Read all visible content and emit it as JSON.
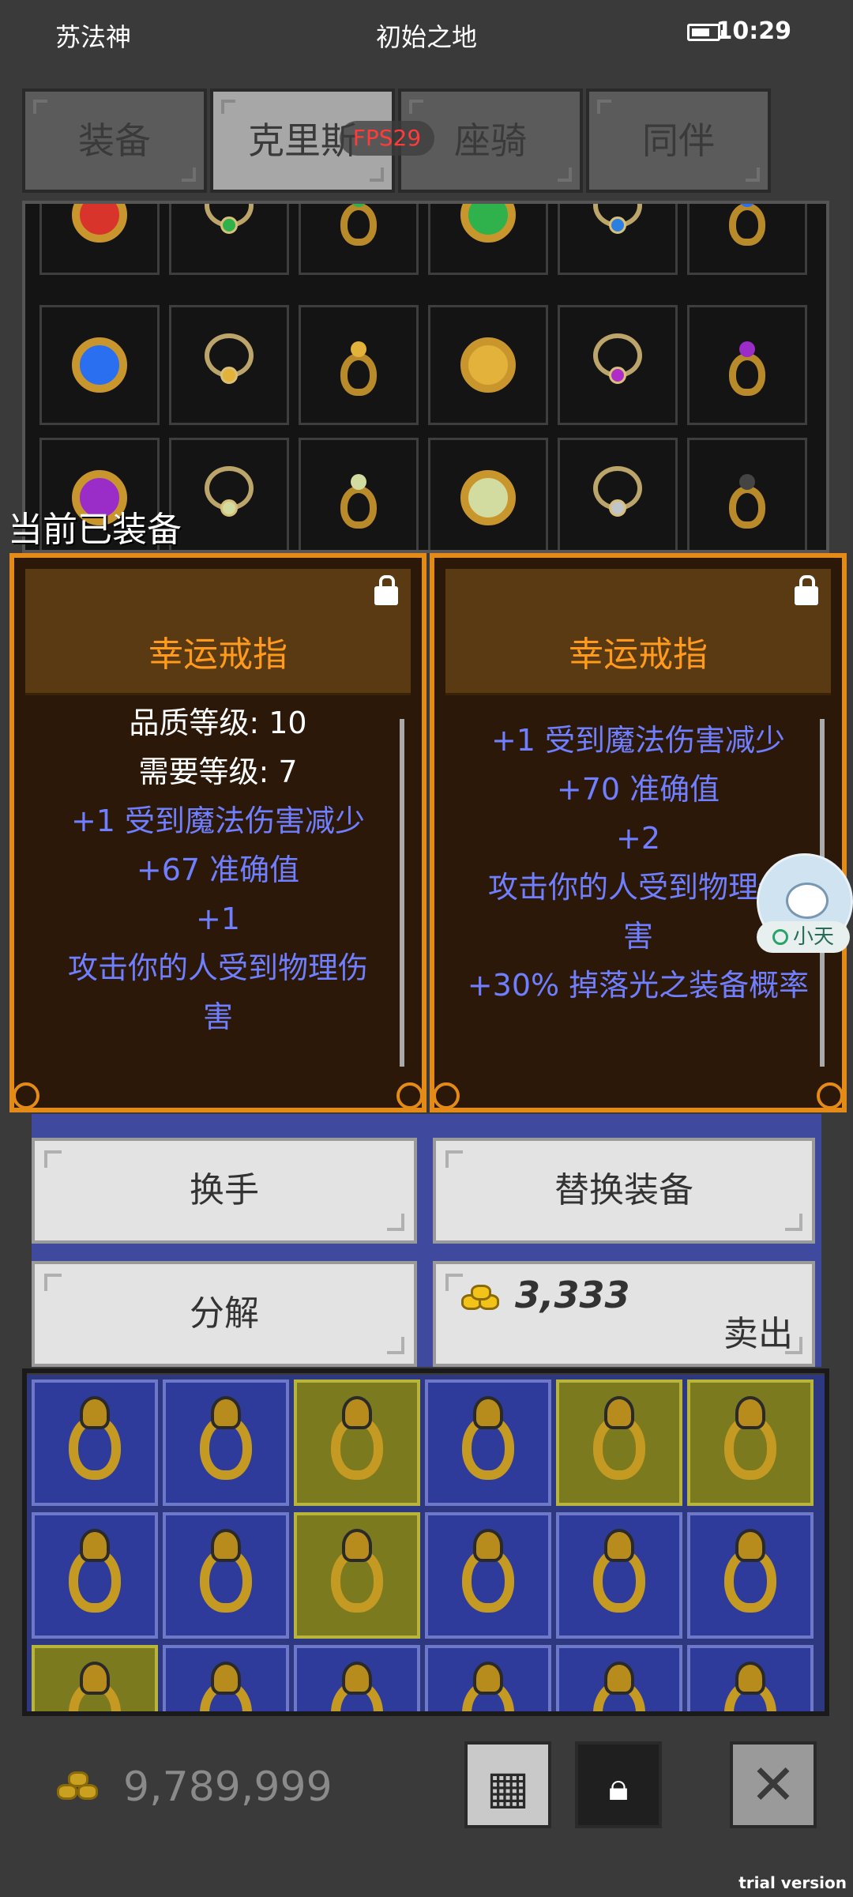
{
  "status": {
    "left_label": "苏法神",
    "center_label": "初始之地",
    "time": "10:29"
  },
  "tabs": [
    {
      "label": "装备",
      "active": false
    },
    {
      "label": "克里斯",
      "active": true
    },
    {
      "label": "座骑",
      "active": false
    },
    {
      "label": "同伴",
      "active": false
    }
  ],
  "fps": "FPS29",
  "equipped_label": "当前已装备",
  "cards": [
    {
      "title": "幸运戒指",
      "lines": [
        {
          "text": "品质等级: 10",
          "color": "white"
        },
        {
          "text": "需要等级: 7",
          "color": "white"
        },
        {
          "text": "+1 受到魔法伤害减少",
          "color": "blue"
        },
        {
          "text": "+67 准确值",
          "color": "blue"
        },
        {
          "text": "+1",
          "color": "blue"
        },
        {
          "text": "攻击你的人受到物理伤",
          "color": "blue"
        },
        {
          "text": "害",
          "color": "blue"
        }
      ]
    },
    {
      "title": "幸运戒指",
      "lines": [
        {
          "text": "+1 受到魔法伤害减少",
          "color": "blue"
        },
        {
          "text": "+70 准确值",
          "color": "blue"
        },
        {
          "text": "+2",
          "color": "blue"
        },
        {
          "text": "攻击你的人受到物理伤",
          "color": "blue"
        },
        {
          "text": "害",
          "color": "blue"
        },
        {
          "text": "+30% 掉落光之装备概率",
          "color": "blue"
        }
      ]
    }
  ],
  "buttons": {
    "swap_hand": "换手",
    "replace_equipment": "替换装备",
    "disassemble": "分解",
    "sell_price": "3,333",
    "sell": "卖出"
  },
  "gold_total": "9,789,999",
  "assistant_label": "小天",
  "trial": "trial version",
  "colors": {
    "accent_orange": "#e48a16",
    "title_orange": "#ff9a1c",
    "stat_blue": "#6f7fff",
    "fps_red": "#ff3b3b"
  },
  "icons": [
    "battery-icon",
    "lock-icon",
    "coins-icon",
    "grid-icon",
    "close-icon"
  ]
}
